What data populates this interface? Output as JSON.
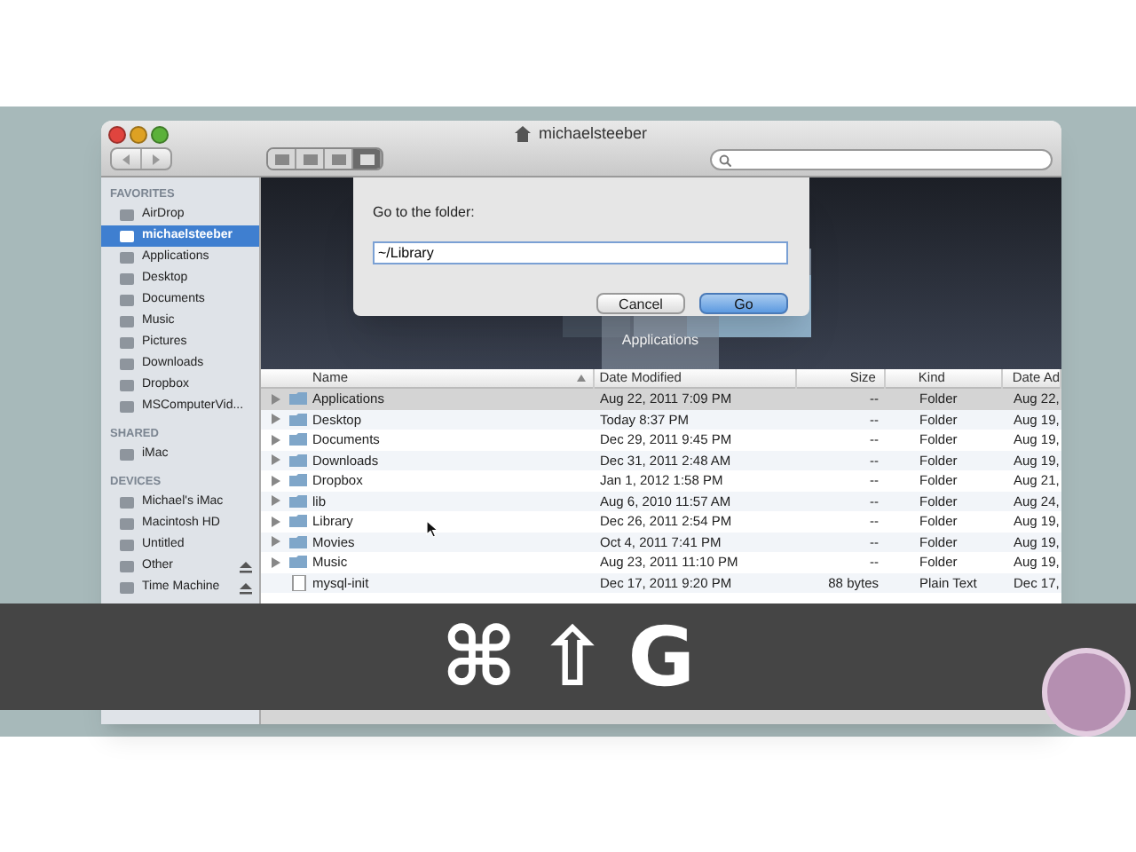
{
  "window": {
    "title": "michaelsteeber"
  },
  "view_buttons": [
    {
      "selected": false
    },
    {
      "selected": false
    },
    {
      "selected": false
    },
    {
      "selected": true
    }
  ],
  "sidebar": [
    {
      "heading": "FAVORITES",
      "items": [
        {
          "label": "AirDrop",
          "selected": false
        },
        {
          "label": "michaelsteeber",
          "selected": true
        },
        {
          "label": "Applications",
          "selected": false
        },
        {
          "label": "Desktop",
          "selected": false
        },
        {
          "label": "Documents",
          "selected": false
        },
        {
          "label": "Music",
          "selected": false
        },
        {
          "label": "Pictures",
          "selected": false
        },
        {
          "label": "Downloads",
          "selected": false
        },
        {
          "label": "Dropbox",
          "selected": false
        },
        {
          "label": "MSComputerVid...",
          "selected": false
        }
      ]
    },
    {
      "heading": "SHARED",
      "items": [
        {
          "label": "iMac",
          "selected": false
        }
      ]
    },
    {
      "heading": "DEVICES",
      "items": [
        {
          "label": "Michael's iMac",
          "selected": false,
          "eject": false
        },
        {
          "label": "Macintosh HD",
          "selected": false,
          "eject": false
        },
        {
          "label": "Untitled",
          "selected": false,
          "eject": false
        },
        {
          "label": "Other",
          "selected": false,
          "eject": true
        },
        {
          "label": "Time Machine",
          "selected": false,
          "eject": true
        }
      ]
    }
  ],
  "dialog": {
    "prompt": "Go to the folder:",
    "value": "~/Library",
    "buttons": [
      {
        "label": "Cancel",
        "default": false
      },
      {
        "label": "Go",
        "default": true
      }
    ]
  },
  "coverflow": {
    "caption": "Applications"
  },
  "table": {
    "columns": [
      {
        "label": "Name",
        "sorted": true
      },
      {
        "label": "Date Modified",
        "sorted": false
      },
      {
        "label": "Size",
        "sorted": false
      },
      {
        "label": "Kind",
        "sorted": false
      },
      {
        "label": "Date Ad",
        "sorted": false
      }
    ],
    "rows": [
      {
        "kind": "folder",
        "name": "Applications",
        "date_modified": "Aug 22, 2011 7:09 PM",
        "size": "--",
        "file_kind": "Folder",
        "date_added": "Aug 22,",
        "selected": true
      },
      {
        "kind": "folder",
        "name": "Desktop",
        "date_modified": "Today 8:37 PM",
        "size": "--",
        "file_kind": "Folder",
        "date_added": "Aug 19,",
        "selected": false
      },
      {
        "kind": "folder",
        "name": "Documents",
        "date_modified": "Dec 29, 2011 9:45 PM",
        "size": "--",
        "file_kind": "Folder",
        "date_added": "Aug 19,",
        "selected": false
      },
      {
        "kind": "folder",
        "name": "Downloads",
        "date_modified": "Dec 31, 2011 2:48 AM",
        "size": "--",
        "file_kind": "Folder",
        "date_added": "Aug 19,",
        "selected": false
      },
      {
        "kind": "folder",
        "name": "Dropbox",
        "date_modified": "Jan 1, 2012 1:58 PM",
        "size": "--",
        "file_kind": "Folder",
        "date_added": "Aug 21,",
        "selected": false
      },
      {
        "kind": "folder",
        "name": "lib",
        "date_modified": "Aug 6, 2010 11:57 AM",
        "size": "--",
        "file_kind": "Folder",
        "date_added": "Aug 24,",
        "selected": false
      },
      {
        "kind": "folder",
        "name": "Library",
        "date_modified": "Dec 26, 2011 2:54 PM",
        "size": "--",
        "file_kind": "Folder",
        "date_added": "Aug 19,",
        "selected": false
      },
      {
        "kind": "folder",
        "name": "Movies",
        "date_modified": "Oct 4, 2011 7:41 PM",
        "size": "--",
        "file_kind": "Folder",
        "date_added": "Aug 19,",
        "selected": false
      },
      {
        "kind": "folder",
        "name": "Music",
        "date_modified": "Aug 23, 2011 11:10 PM",
        "size": "--",
        "file_kind": "Folder",
        "date_added": "Aug 19,",
        "selected": false
      },
      {
        "kind": "file",
        "name": "mysql-init",
        "date_modified": "Dec 17, 2011 9:20 PM",
        "size": "88 bytes",
        "file_kind": "Plain Text",
        "date_added": "Dec 17,",
        "selected": false
      }
    ]
  },
  "shortcut_keys": [
    "⌘",
    "⇧",
    "G"
  ]
}
